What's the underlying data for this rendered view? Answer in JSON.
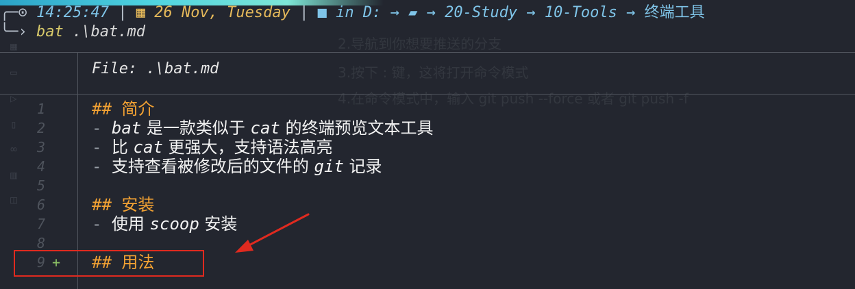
{
  "prompt": {
    "time": "14:25:47",
    "separator": "|",
    "date": "26 Nov, Tuesday",
    "in_word": "in",
    "drive": "D:",
    "path_parts": [
      "20-Study",
      "10-Tools",
      "终端工具"
    ],
    "command": "bat",
    "argument": ".\\bat.md"
  },
  "background_ghost": [
    "2.导航到你想要推送的分支",
    "3.按下 : 键，这将打开命令模式",
    "4.在命令模式中，输入 git push --force 或者 git push -f"
  ],
  "file_header": "File: .\\bat.md",
  "lines": [
    {
      "num": "1",
      "segments": [
        {
          "t": "## ",
          "c": "head"
        },
        {
          "t": "简介",
          "c": "head zh"
        }
      ]
    },
    {
      "num": "2",
      "segments": [
        {
          "t": "- ",
          "c": "dash"
        },
        {
          "t": "bat",
          "c": "it"
        },
        {
          "t": " 是一款类似于 ",
          "c": "zh"
        },
        {
          "t": "cat",
          "c": "it"
        },
        {
          "t": " 的终端预览文本工具",
          "c": "zh"
        }
      ]
    },
    {
      "num": "3",
      "segments": [
        {
          "t": "- ",
          "c": "dash"
        },
        {
          "t": "比 ",
          "c": "zh"
        },
        {
          "t": "cat",
          "c": "it"
        },
        {
          "t": " 更强大，支持语法高亮",
          "c": "zh"
        }
      ]
    },
    {
      "num": "4",
      "segments": [
        {
          "t": "- ",
          "c": "dash"
        },
        {
          "t": "支持查看被修改后的文件的 ",
          "c": "zh"
        },
        {
          "t": "git",
          "c": "it"
        },
        {
          "t": " 记录",
          "c": "zh"
        }
      ]
    },
    {
      "num": "5",
      "segments": []
    },
    {
      "num": "6",
      "segments": [
        {
          "t": "## ",
          "c": "head"
        },
        {
          "t": "安装",
          "c": "head zh"
        }
      ]
    },
    {
      "num": "7",
      "segments": [
        {
          "t": "- ",
          "c": "dash"
        },
        {
          "t": "使用 ",
          "c": "zh"
        },
        {
          "t": "scoop",
          "c": "it"
        },
        {
          "t": " 安装",
          "c": "zh"
        }
      ]
    },
    {
      "num": "8",
      "segments": []
    },
    {
      "num": "9",
      "git": "+",
      "segments": [
        {
          "t": "## ",
          "c": "head"
        },
        {
          "t": "用法",
          "c": "head zh"
        }
      ]
    }
  ],
  "colors": {
    "background": "#23262f",
    "heading": "#f3a233",
    "annotation": "#e02a1f",
    "git_added": "#8cc265"
  },
  "icons": [
    "clock-icon",
    "calendar-icon",
    "folder-icon",
    "folder-open-icon",
    "arrow-right-icon"
  ]
}
